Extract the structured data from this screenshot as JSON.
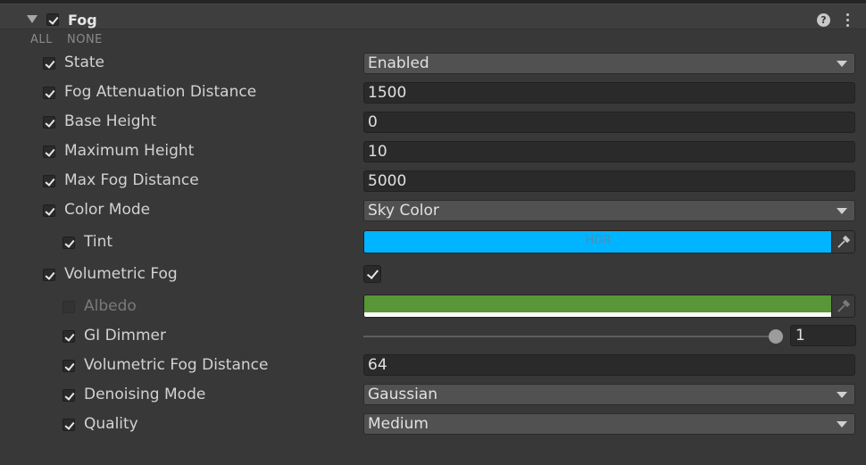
{
  "header": {
    "title": "Fog",
    "enabled": true,
    "help_icon": "help-icon",
    "menu_icon": "kebab-menu-icon",
    "foldout_icon": "foldout-triangle-icon"
  },
  "toolbar": {
    "all_label": "ALL",
    "none_label": "NONE"
  },
  "rows": {
    "state": {
      "label": "State",
      "value": "Enabled",
      "override": true
    },
    "attenuation": {
      "label": "Fog Attenuation Distance",
      "value": "1500",
      "override": true
    },
    "base_height": {
      "label": "Base Height",
      "value": "0",
      "override": true
    },
    "max_height": {
      "label": "Maximum Height",
      "value": "10",
      "override": true
    },
    "max_distance": {
      "label": "Max Fog Distance",
      "value": "5000",
      "override": true
    },
    "color_mode": {
      "label": "Color Mode",
      "value": "Sky Color",
      "override": true
    },
    "tint": {
      "label": "Tint",
      "hdr_label": "HDR",
      "color": "#00b4ff",
      "override": true
    },
    "volumetric": {
      "label": "Volumetric Fog",
      "value": true,
      "override": true
    },
    "albedo": {
      "label": "Albedo",
      "color": "#589637",
      "alpha_color": "#ffffff",
      "override": false
    },
    "gi_dimmer": {
      "label": "GI Dimmer",
      "value": "1",
      "slider_fraction": 1.0,
      "override": true
    },
    "vol_distance": {
      "label": "Volumetric Fog Distance",
      "value": "64",
      "override": true
    },
    "denoising": {
      "label": "Denoising Mode",
      "value": "Gaussian",
      "override": true
    },
    "quality": {
      "label": "Quality",
      "value": "Medium",
      "override": true
    }
  },
  "icons": {
    "checkbox": "checkmark-icon",
    "dropdown": "chevron-down-icon",
    "color_picker": "eyedropper-icon"
  }
}
